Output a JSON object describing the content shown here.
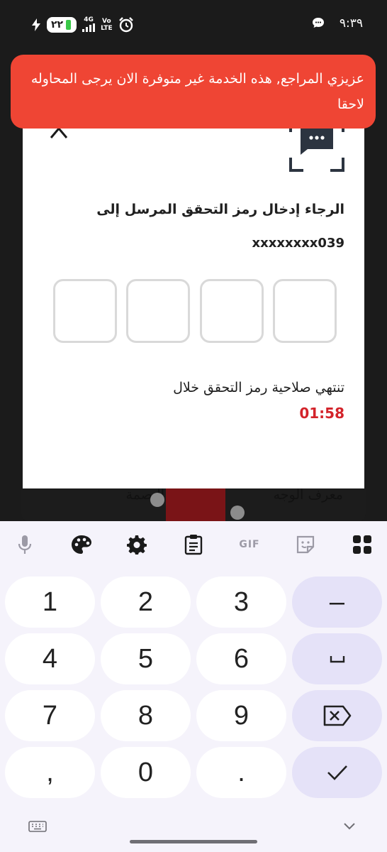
{
  "status_bar": {
    "time": "٩:٣٩",
    "battery": "٢٢",
    "network_4g": "4G",
    "volte_top": "Vo",
    "volte_bottom": "LTE"
  },
  "background": {
    "face_id_label": "معرف الوجه",
    "fingerprint_label": "البصمة"
  },
  "dialog": {
    "title": "الرجاء إدخال رمز التحقق المرسل إلى",
    "phone": "xxxxxxxx039",
    "otp_digits": [
      "",
      "",
      "",
      ""
    ],
    "expiry_text": "تنتهي صلاحية رمز التحقق خلال",
    "timer": "01:58"
  },
  "toast": {
    "message": "عزيزي المراجع, هذه الخدمة غير متوفرة الان يرجى المحاوله لاحقا"
  },
  "keyboard": {
    "toolbar": {
      "gif": "GIF"
    },
    "keys": {
      "k1": "1",
      "k2": "2",
      "k3": "3",
      "minus": "–",
      "k4": "4",
      "k5": "5",
      "k6": "6",
      "space": "␣",
      "k7": "7",
      "k8": "8",
      "k9": "9",
      "comma": ",",
      "k0": "0",
      "period": "."
    }
  },
  "colors": {
    "toast": "#ef4534",
    "timer": "#d3232a",
    "keyboard_bg": "#f5f3fb",
    "fn_key": "#e5e2f8"
  }
}
